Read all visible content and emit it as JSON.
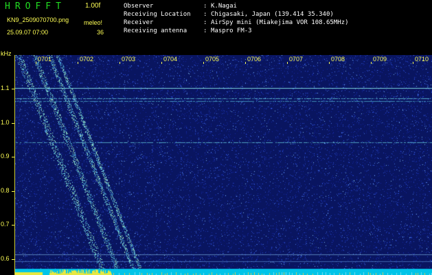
{
  "header": {
    "logo": "HROFFT",
    "version": "1.00f",
    "filename": "KN9_2509070700.png",
    "meleo_label": "meleo!",
    "datetime": "25.09.07 07:00",
    "count": "36",
    "info": [
      {
        "label": "Observer",
        "value": "K.Nagai"
      },
      {
        "label": "Receiving Location",
        "value": "Chigasaki, Japan (139.414 35.340)"
      },
      {
        "label": "Receiver",
        "value": "AirSpy mini (Miakejima VOR 108.65MHz)"
      },
      {
        "label": "Receiving antenna",
        "value": "Maspro FM-3"
      }
    ],
    "separator": ":"
  },
  "axis": {
    "unit": "kHz",
    "ticks": [
      "1.1",
      "1.0",
      "0.9",
      "0.8",
      "0.7",
      "0.6"
    ],
    "tick_values": [
      1.1,
      1.0,
      0.9,
      0.8,
      0.7,
      0.6
    ]
  },
  "time_labels": [
    "0701",
    "0702",
    "0703",
    "0704",
    "0705",
    "0706",
    "0707",
    "0708",
    "0709",
    "0710"
  ],
  "colors": {
    "background": "#000000",
    "noise": "#0a1a6e",
    "header_text": "#ffff55",
    "logo": "#22dd22",
    "info_text": "#ffffff",
    "carrier": "#66dddd",
    "band": "#00ccee"
  }
}
